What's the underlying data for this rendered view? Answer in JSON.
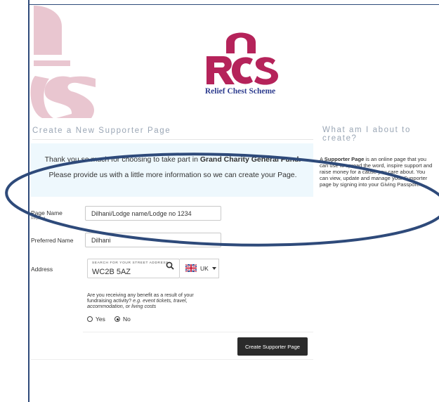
{
  "brand": {
    "logo_letters": "RCS",
    "name": "Relief Chest Scheme",
    "primary_color": "#b5235a",
    "text_color": "#2f3e8f"
  },
  "page": {
    "heading": "Create a New Supporter Page",
    "side_heading": "What am I about to create?"
  },
  "banner": {
    "thanks_prefix": "Thank you so much for choosing to take part in ",
    "thanks_fund": "Grand Charity General Fund.",
    "provide": "Please provide us with a little more information so we can create your Page."
  },
  "side_info": {
    "prefix": "A ",
    "strong": "Supporter Page",
    "rest": " is an online page that you can use to spread the word, inspire support and raise money for a cause you care about. You can view, update and manage your Supporter page by signing into your Giving Passport."
  },
  "form": {
    "page_name_label": "Page Name",
    "required_label": "Required",
    "page_name_value": "Dilhani/Lodge name/Lodge no 1234",
    "preferred_name_label": "Preferred Name",
    "preferred_name_value": "Dilhani",
    "address_label": "Address",
    "address_placeholder": "SEARCH FOR YOUR STREET ADDRESS",
    "address_value": "WC2B 5AZ",
    "country_code": "UK",
    "benefit_q_main": "Are you receiving any benefit as a result of your fundraising activity? ",
    "benefit_q_eg": "e.g. event tickets, travel, accommodation, or living costs",
    "yes_label": "Yes",
    "no_label": "No",
    "selected_option": "No",
    "submit_label": "Create Supporter Page"
  },
  "annotation": {
    "ellipse_color": "#2e4a7a"
  }
}
